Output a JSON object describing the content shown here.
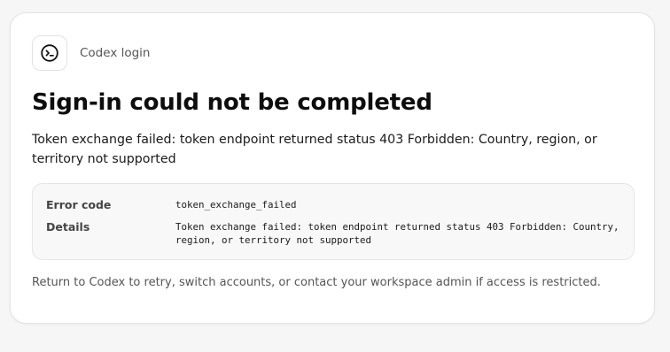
{
  "header": {
    "app_name": "Codex login",
    "icon": "terminal-icon"
  },
  "title": "Sign-in could not be completed",
  "message": "Token exchange failed: token endpoint returned status 403 Forbidden: Country, region, or territory not supported",
  "error": {
    "code_label": "Error code",
    "code_value": "token_exchange_failed",
    "details_label": "Details",
    "details_value": "Token exchange failed: token endpoint returned status 403 Forbidden: Country, region, or territory not supported"
  },
  "footer_text": "Return to Codex to retry, switch accounts, or contact your workspace admin if access is restricted.",
  "colors": {
    "background": "#f6f6f6",
    "card": "#ffffff",
    "details_box": "#f8f8f8",
    "text": "#111111",
    "muted_text": "#555555"
  }
}
